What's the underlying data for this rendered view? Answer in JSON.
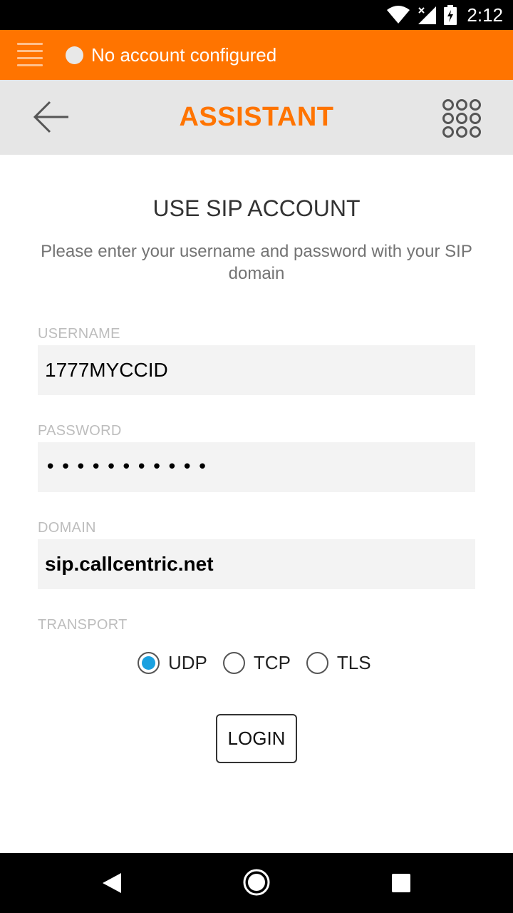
{
  "status_bar": {
    "time": "2:12",
    "icons": [
      "wifi-icon",
      "signal-icon",
      "battery-charging-icon"
    ]
  },
  "account_bar": {
    "status_text": "No account configured",
    "icons": [
      "menu-icon",
      "status-dot-icon"
    ]
  },
  "top_bar": {
    "title": "ASSISTANT",
    "icons": [
      "back-arrow-icon",
      "dialer-icon"
    ]
  },
  "main": {
    "heading": "USE SIP ACCOUNT",
    "subtitle": "Please enter your username and password with your SIP domain",
    "fields": {
      "username": {
        "label": "USERNAME",
        "value": "1777MYCCID"
      },
      "password": {
        "label": "PASSWORD",
        "masked_value": "•••••••••••"
      },
      "domain": {
        "label": "DOMAIN",
        "value": "sip.callcentric.net"
      }
    },
    "transport": {
      "label": "TRANSPORT",
      "options": [
        "UDP",
        "TCP",
        "TLS"
      ],
      "selected": "UDP"
    },
    "login_label": "LOGIN"
  },
  "colors": {
    "accent": "#ff7400",
    "topbar_bg": "#e6e6e6",
    "field_bg": "#f3f3f3",
    "radio_selected": "#1aa1e0"
  },
  "nav_bar": {
    "icons": [
      "nav-back-icon",
      "nav-home-icon",
      "nav-recent-icon"
    ]
  }
}
